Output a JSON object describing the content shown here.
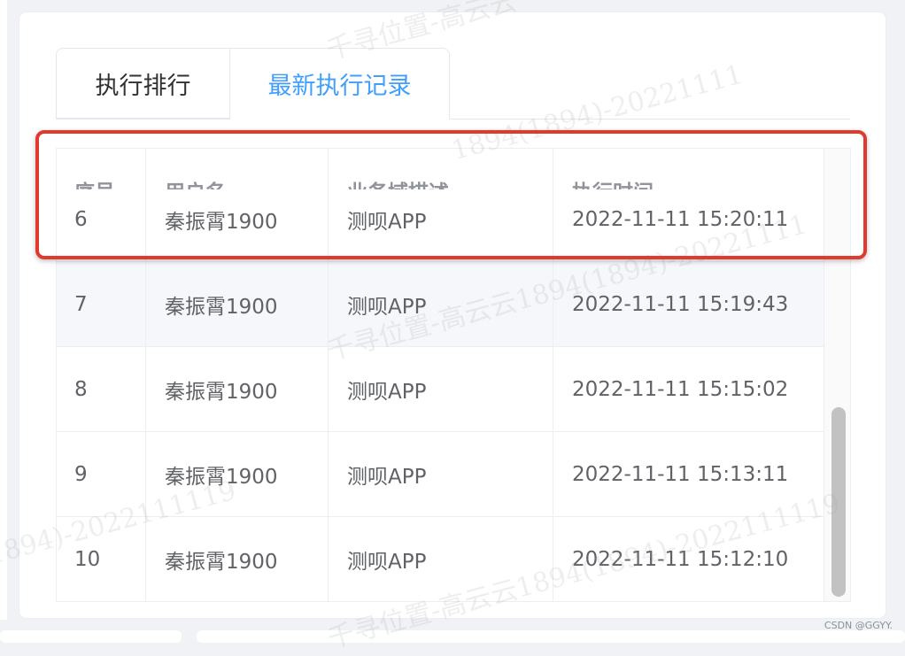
{
  "tabs": [
    {
      "label": "执行排行",
      "active": false
    },
    {
      "label": "最新执行记录",
      "active": true
    }
  ],
  "table": {
    "columns": [
      "序号",
      "用户名",
      "业务域描述",
      "执行时间"
    ],
    "rows": [
      {
        "index": "6",
        "user": "秦振霄1900",
        "domain": "测呗APP",
        "time": "2022-11-11 15:20:11"
      },
      {
        "index": "7",
        "user": "秦振霄1900",
        "domain": "测呗APP",
        "time": "2022-11-11 15:19:43"
      },
      {
        "index": "8",
        "user": "秦振霄1900",
        "domain": "测呗APP",
        "time": "2022-11-11 15:15:02"
      },
      {
        "index": "9",
        "user": "秦振霄1900",
        "domain": "测呗APP",
        "time": "2022-11-11 15:13:11"
      },
      {
        "index": "10",
        "user": "秦振霄1900",
        "domain": "测呗APP",
        "time": "2022-11-11 15:12:10"
      }
    ]
  },
  "watermarks": [
    "千寻位置-高云云",
    "1894(1894)-20221111",
    "千寻位置-高云云1894(1894)-20221111",
    "(1894)-2022111119",
    "千寻位置-高云云1894(1894)-2022111119"
  ],
  "credit": "CSDN @GGYY.",
  "colors": {
    "tab_active": "#409eff",
    "highlight_border": "#e03a2f",
    "stripe": "#f5f7fa"
  }
}
